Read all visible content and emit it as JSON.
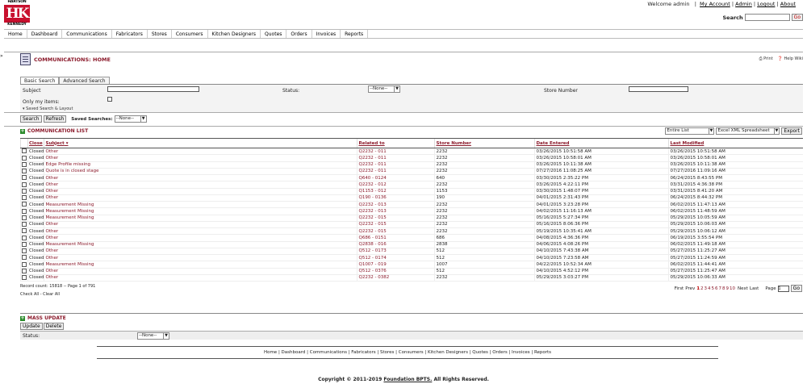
{
  "logo": {
    "top": "HARTSON",
    "mark": "HK",
    "bottom": "KENNEDY"
  },
  "user": {
    "welcome": "Welcome admin",
    "links": [
      "My Account",
      "Admin",
      "Logout",
      "About"
    ]
  },
  "search": {
    "label": "Search",
    "go": "Go"
  },
  "nav": [
    "Home",
    "Dashboard",
    "Communications",
    "Fabricators",
    "Stores",
    "Consumers",
    "Kitchen Designers",
    "Quotes",
    "Orders",
    "Invoices",
    "Reports"
  ],
  "page": {
    "title": "COMMUNICATIONS: HOME",
    "print": "Print",
    "help": "Help Wiki",
    "side_marker": "»"
  },
  "tabs": [
    "Basic Search",
    "Advanced Search"
  ],
  "filters": {
    "subject_label": "Subject",
    "status_label": "Status:",
    "status_value": "--None--",
    "store_label": "Store Number",
    "only_my_label": "Only my items:",
    "saved_link": "Saved Search & Layout"
  },
  "actions": {
    "search": "Search",
    "refresh": "Refresh",
    "saved_label": "Saved Searches:",
    "saved_value": "--None--"
  },
  "list": {
    "title": "COMMUNICATION LIST",
    "export_scope": "Entire List",
    "export_format": "Excel XML Spreadsheet",
    "export_btn": "Export",
    "columns": {
      "close": "Close",
      "subject": "Subject",
      "related": "Related to",
      "store": "Store Number",
      "entered": "Date Entered",
      "modified": "Last Modified"
    },
    "rows": [
      {
        "status": "Closed",
        "subject": "Other",
        "related": "Q2232 - 011",
        "store": "2232",
        "entered": "03/26/2015 10:51:58 AM",
        "modified": "03/26/2015 10:51:58 AM"
      },
      {
        "status": "Closed",
        "subject": "Other",
        "related": "Q2232 - 011",
        "store": "2232",
        "entered": "03/26/2015 10:58:01 AM",
        "modified": "03/26/2015 10:58:01 AM"
      },
      {
        "status": "Closed",
        "subject": "Edge Profile missing",
        "related": "Q2232 - 011",
        "store": "2232",
        "entered": "03/26/2015 10:11:38 AM",
        "modified": "03/26/2015 10:11:38 AM"
      },
      {
        "status": "Closed",
        "subject": "Quote is in closed stage",
        "related": "Q2232 - 011",
        "store": "2232",
        "entered": "07/27/2016 11:08:25 AM",
        "modified": "07/27/2016 11:09:16 AM"
      },
      {
        "status": "Closed",
        "subject": "Other",
        "related": "Q640 - 0124",
        "store": "640",
        "entered": "03/30/2015 2:35:22 PM",
        "modified": "06/24/2015 8:43:55 PM"
      },
      {
        "status": "Closed",
        "subject": "Other",
        "related": "Q2232 - 012",
        "store": "2232",
        "entered": "03/26/2015 4:22:11 PM",
        "modified": "03/31/2015 4:36:38 PM"
      },
      {
        "status": "Closed",
        "subject": "Other",
        "related": "Q1153 - 012",
        "store": "1153",
        "entered": "03/30/2015 1:48:07 PM",
        "modified": "03/31/2015 8:41:20 AM"
      },
      {
        "status": "Closed",
        "subject": "Other",
        "related": "Q190 - 0136",
        "store": "190",
        "entered": "04/01/2015 2:31:43 PM",
        "modified": "06/24/2015 8:44:32 PM"
      },
      {
        "status": "Closed",
        "subject": "Measurement Missing",
        "related": "Q2232 - 013",
        "store": "2232",
        "entered": "04/01/2015 3:23:28 PM",
        "modified": "06/02/2015 11:47:13 AM"
      },
      {
        "status": "Closed",
        "subject": "Measurement Missing",
        "related": "Q2232 - 013",
        "store": "2232",
        "entered": "04/02/2015 11:16:13 AM",
        "modified": "06/02/2015 11:48:59 AM"
      },
      {
        "status": "Closed",
        "subject": "Measurement Missing",
        "related": "Q2232 - 015",
        "store": "2232",
        "entered": "05/16/2015 5:27:34 PM",
        "modified": "05/29/2015 10:05:59 AM"
      },
      {
        "status": "Closed",
        "subject": "Other",
        "related": "Q2232 - 015",
        "store": "2232",
        "entered": "05/16/2015 8:06:36 PM",
        "modified": "05/29/2015 10:06:03 AM"
      },
      {
        "status": "Closed",
        "subject": "Other",
        "related": "Q2232 - 015",
        "store": "2232",
        "entered": "05/19/2015 10:35:41 AM",
        "modified": "05/29/2015 10:06:12 AM"
      },
      {
        "status": "Closed",
        "subject": "Other",
        "related": "Q686 - 0151",
        "store": "686",
        "entered": "04/08/2015 4:36:36 PM",
        "modified": "06/19/2015 3:55:54 PM"
      },
      {
        "status": "Closed",
        "subject": "Measurement Missing",
        "related": "Q2838 - 016",
        "store": "2838",
        "entered": "04/06/2015 4:08:26 PM",
        "modified": "06/02/2015 11:49:18 AM"
      },
      {
        "status": "Closed",
        "subject": "Other",
        "related": "Q512 - 0173",
        "store": "512",
        "entered": "04/10/2015 7:43:38 AM",
        "modified": "05/27/2015 11:25:27 AM"
      },
      {
        "status": "Closed",
        "subject": "Other",
        "related": "Q512 - 0174",
        "store": "512",
        "entered": "04/10/2015 7:23:58 AM",
        "modified": "05/27/2015 11:24:59 AM"
      },
      {
        "status": "Closed",
        "subject": "Measurement Missing",
        "related": "Q1007 - 019",
        "store": "1007",
        "entered": "04/22/2015 10:52:34 AM",
        "modified": "06/02/2015 11:44:41 AM"
      },
      {
        "status": "Closed",
        "subject": "Other",
        "related": "Q512 - 0376",
        "store": "512",
        "entered": "04/10/2015 4:52:12 PM",
        "modified": "05/27/2015 11:25:47 AM"
      },
      {
        "status": "Closed",
        "subject": "Other",
        "related": "Q2232 - 0382",
        "store": "2232",
        "entered": "05/29/2015 3:03:27 PM",
        "modified": "05/29/2015 10:06:33 AM"
      }
    ],
    "record_count": "Record count: 15818 -- Page 1 of 791",
    "check_all": "Check All - Clear All"
  },
  "pager": {
    "first": "First",
    "prev": "Prev",
    "pages": [
      "1",
      "2",
      "3",
      "4",
      "5",
      "6",
      "7",
      "8",
      "9",
      "10"
    ],
    "next": "Next",
    "last": "Last",
    "page_label": "Page",
    "page_value": "1",
    "go": "Go"
  },
  "mass": {
    "title": "MASS UPDATE",
    "update": "Update",
    "delete": "Delete",
    "status_label": "Status:",
    "status_value": "--None--"
  },
  "footer": {
    "links": "Home | Dashboard | Communications | Fabricators | Stores | Consumers | Kitchen Designers | Quotes | Orders | Invoices | Reports",
    "copyright_pre": "Copyright © 2011-2019",
    "foundation": "Foundation BPTS.",
    "copyright_post": "All Rights Reserved."
  },
  "colors": {
    "accent": "#8b1a2b",
    "logo": "#c8102e",
    "add_icon": "#2a8a2a"
  }
}
